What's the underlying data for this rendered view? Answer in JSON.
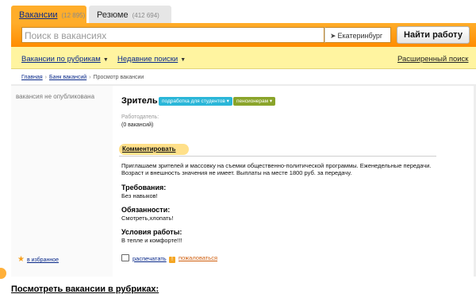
{
  "tabs": [
    {
      "label": "Вакансии",
      "count": "(12 895)"
    },
    {
      "label": "Резюме",
      "count": "(412 694)"
    }
  ],
  "search": {
    "placeholder": "Поиск в вакансиях",
    "city": "Екатеринбург",
    "button": "Найти работу"
  },
  "nav": {
    "rubrics": "Вакансии по рубрикам",
    "recent": "Недавние поиски",
    "advanced": "Расширенный поиск"
  },
  "breadcrumb": [
    "Главная",
    "Банк вакансий",
    "Просмотр вакансии"
  ],
  "left": {
    "status": "вакансия не опубликована",
    "favorite": "в избранное"
  },
  "vacancy": {
    "title": "Зритель",
    "tags": [
      "подработка для студентов",
      "пенсионерам"
    ],
    "employer_label": "Работодатель:",
    "employer_value": "(0 вакансий)",
    "comment": "Комментировать",
    "description": "Приглашаем зрителей и массовку на съемки общественно-политической программы. Еженедельные передачи. Возраст и внешность значения не имеет. Выплаты на месте 1800 руб. за передачу.",
    "sections": [
      {
        "title": "Требования:",
        "text": "Без навыков!"
      },
      {
        "title": "Обязанности:",
        "text": "Смотреть,хлопать!"
      },
      {
        "title": "Условия работы:",
        "text": "В тепле и комфорте!!!"
      }
    ],
    "print": "распечатать",
    "complain": "пожаловаться"
  },
  "bottom_heading": "Посмотреть вакансии в рубриках:"
}
